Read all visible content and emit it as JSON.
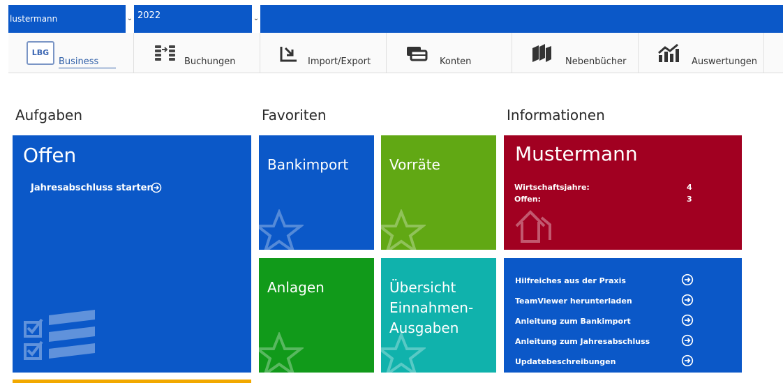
{
  "topbar": {
    "client_value": "lustermann",
    "year_value": "2022",
    "dropdown_glyph": "⌄"
  },
  "ribbon": {
    "logo_text": "LBG",
    "tabs": [
      {
        "label": "Business",
        "icon": "lbg-logo"
      },
      {
        "label": "Buchungen",
        "icon": "coins-icon"
      },
      {
        "label": "Import/Export",
        "icon": "import-export-icon"
      },
      {
        "label": "Konten",
        "icon": "wallet-icon"
      },
      {
        "label": "Nebenbücher",
        "icon": "books-icon"
      },
      {
        "label": "Auswertungen",
        "icon": "chart-icon"
      }
    ]
  },
  "sections": {
    "aufgaben": "Aufgaben",
    "favoriten": "Favoriten",
    "informationen": "Informationen"
  },
  "aufgaben": {
    "title": "Offen",
    "link": "Jahresabschluss starten"
  },
  "favoriten": {
    "tiles": [
      {
        "label": "Bankimport",
        "color": "#0b58c8"
      },
      {
        "label": "Vorräte",
        "color": "#61a814"
      },
      {
        "label": "Anlagen",
        "color": "#119a1a"
      },
      {
        "label_lines": [
          "Übersicht",
          "Einnahmen-",
          "Ausgaben"
        ],
        "color": "#10b2ac"
      }
    ]
  },
  "informationen": {
    "title": "Mustermann",
    "rows": [
      {
        "label": "Wirtschaftsjahre:",
        "value": "4"
      },
      {
        "label": "Offen:",
        "value": "3"
      }
    ],
    "links": [
      "Hilfreiches aus der Praxis",
      "TeamViewer herunterladen",
      "Anleitung zum Bankimport",
      "Anleitung zum Jahresabschluss",
      "Updatebeschreibungen"
    ]
  },
  "colors": {
    "brand_blue": "#0b58c8",
    "red_tile": "#a10021",
    "green_tile": "#119a1a",
    "lime_tile": "#61a814",
    "teal_tile": "#10b2ac",
    "orange_strip": "#f2a900"
  }
}
